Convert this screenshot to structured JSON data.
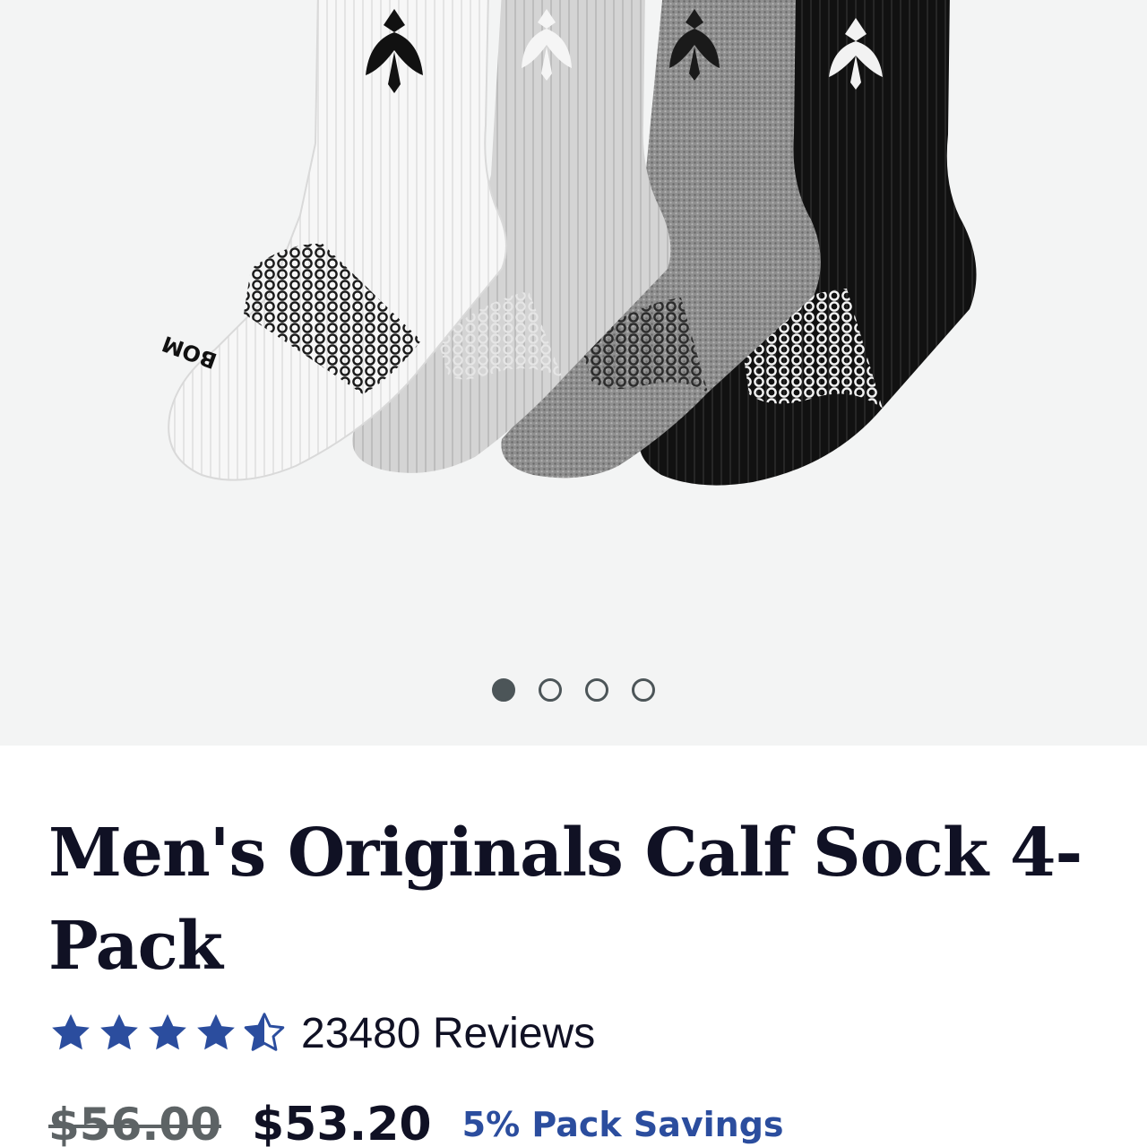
{
  "product": {
    "title": "Men's Originals Calf Sock 4-Pack",
    "image": {
      "subject": "four calf socks with bee logo",
      "sock_colors": [
        "#f5f5f5",
        "#cfcfcf",
        "#8d8d8d",
        "#111111"
      ],
      "brand_text": "BOM"
    },
    "carousel": {
      "slide_count": 4,
      "active_index": 0
    },
    "rating": {
      "stars": 4.5,
      "max": 5,
      "star_color": "#2b4d9e",
      "review_label": "23480 Reviews"
    },
    "price": {
      "original": "$56.00",
      "current": "$53.20",
      "savings_label": "5% Pack Savings",
      "savings_color": "#2b4d9e"
    }
  }
}
